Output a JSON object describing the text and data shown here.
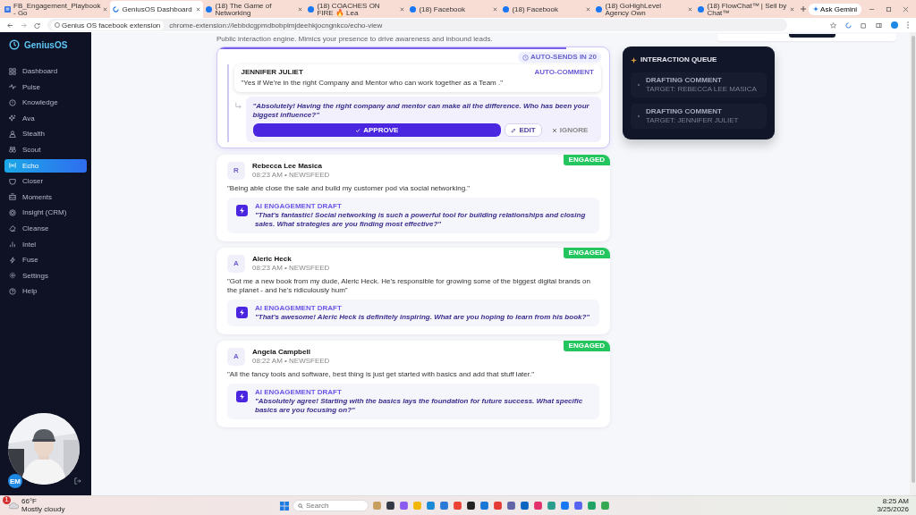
{
  "browser": {
    "tabs": [
      {
        "title": "FB_Engagement_Playbook - Go",
        "selected": false,
        "kind": "doc"
      },
      {
        "title": "GeniusOS Dashboard",
        "selected": true,
        "kind": "loading"
      },
      {
        "title": "(18) The Game of Networking",
        "selected": false,
        "kind": "social"
      },
      {
        "title": "(18) COACHES ON FIRE 🔥 Lea",
        "selected": false,
        "kind": "social"
      },
      {
        "title": "(18) Facebook",
        "selected": false,
        "kind": "social"
      },
      {
        "title": "(18) Facebook",
        "selected": false,
        "kind": "social"
      },
      {
        "title": "(18) GoHighLevel Agency Own",
        "selected": false,
        "kind": "social"
      },
      {
        "title": "(18) FlowChat™ | Sell by Chat™",
        "selected": false,
        "kind": "social"
      }
    ],
    "gemini": "Ask Gemini",
    "site_chip": "Genius OS facebook extension",
    "url": "chrome-extension://lebbdcgpmdbobplmjdeehkjocngnkco/echo-view"
  },
  "sidebar": {
    "brand": "GeniusOS",
    "items": [
      {
        "label": "Dashboard",
        "selected": false
      },
      {
        "label": "Pulse",
        "selected": false
      },
      {
        "label": "Knowledge",
        "selected": false
      },
      {
        "label": "Ava",
        "selected": false
      },
      {
        "label": "Stealth",
        "selected": false
      },
      {
        "label": "Scout",
        "selected": false
      },
      {
        "label": "Echo",
        "selected": true
      },
      {
        "label": "Closer",
        "selected": false
      },
      {
        "label": "Moments",
        "selected": false
      },
      {
        "label": "Insight (CRM)",
        "selected": false
      },
      {
        "label": "Cleanse",
        "selected": false
      },
      {
        "label": "Intel",
        "selected": false
      },
      {
        "label": "Fuse",
        "selected": false
      },
      {
        "label": "Settings",
        "selected": false
      },
      {
        "label": "Help",
        "selected": false
      }
    ],
    "user_initials": "EM"
  },
  "page": {
    "description": "Public interaction engine. Mimics your presence to drive awareness and inbound leads."
  },
  "active_comment": {
    "timer": "AUTO-SENDS IN 20",
    "level": 0.89,
    "author": "JENNIFER JULIET",
    "type_label": "AUTO-COMMENT",
    "comment": "\"Yes if We're in the right Company and Mentor who can work together as a Team .\"",
    "reply": "\"Absolutely! Having the right company and mentor can make all the difference. Who has been your biggest influence?\"",
    "actions": [
      "APPROVE",
      "EDIT",
      "IGNORE"
    ]
  },
  "feed": [
    {
      "status": "ENGAGED",
      "initial": "R",
      "name": "Rebecca Lee Masica",
      "meta": "08:23 AM • NEWSFEED",
      "comment": "\"Being able close the sale and build my customer pod via social networking.\"",
      "draft_label": "AI ENGAGEMENT DRAFT",
      "draft": "\"That's fantastic! Social networking is such a powerful tool for building relationships and closing sales. What strategies are you finding most effective?\""
    },
    {
      "status": "ENGAGED",
      "initial": "A",
      "name": "Aleric Heck",
      "meta": "08:23 AM • NEWSFEED",
      "comment": "\"Got me a new book from my dude, Aleric Heck. He's responsible for growing some of the biggest digital brands on the planet - and he's ridiculously hum\"",
      "draft_label": "AI ENGAGEMENT DRAFT",
      "draft": "\"That's awesome! Aleric Heck is definitely inspiring. What are you hoping to learn from his book?\""
    },
    {
      "status": "ENGAGED",
      "initial": "A",
      "name": "Angela Campbell",
      "meta": "08:22 AM • NEWSFEED",
      "comment": "\"All the fancy tools and software, best thing is just get started with basics and add that stuff later.\"",
      "draft_label": "AI ENGAGEMENT DRAFT",
      "draft": "\"Absolutely agree! Starting with the basics lays the foundation for future success. What specific basics are you focusing on?\""
    }
  ],
  "queue": {
    "title": "INTERACTION QUEUE",
    "items": [
      {
        "status": "DRAFTING COMMENT",
        "target": "TARGET: REBECCA LEE MASICA"
      },
      {
        "status": "DRAFTING COMMENT",
        "target": "TARGET: JENNIFER JULIET"
      }
    ]
  },
  "taskbar": {
    "weather": {
      "badge": "1",
      "temp": "66°F",
      "condition": "Mostly cloudy"
    },
    "search": {
      "placeholder": "Search"
    },
    "time": "8:25 AM",
    "date": "3/25/2026"
  }
}
